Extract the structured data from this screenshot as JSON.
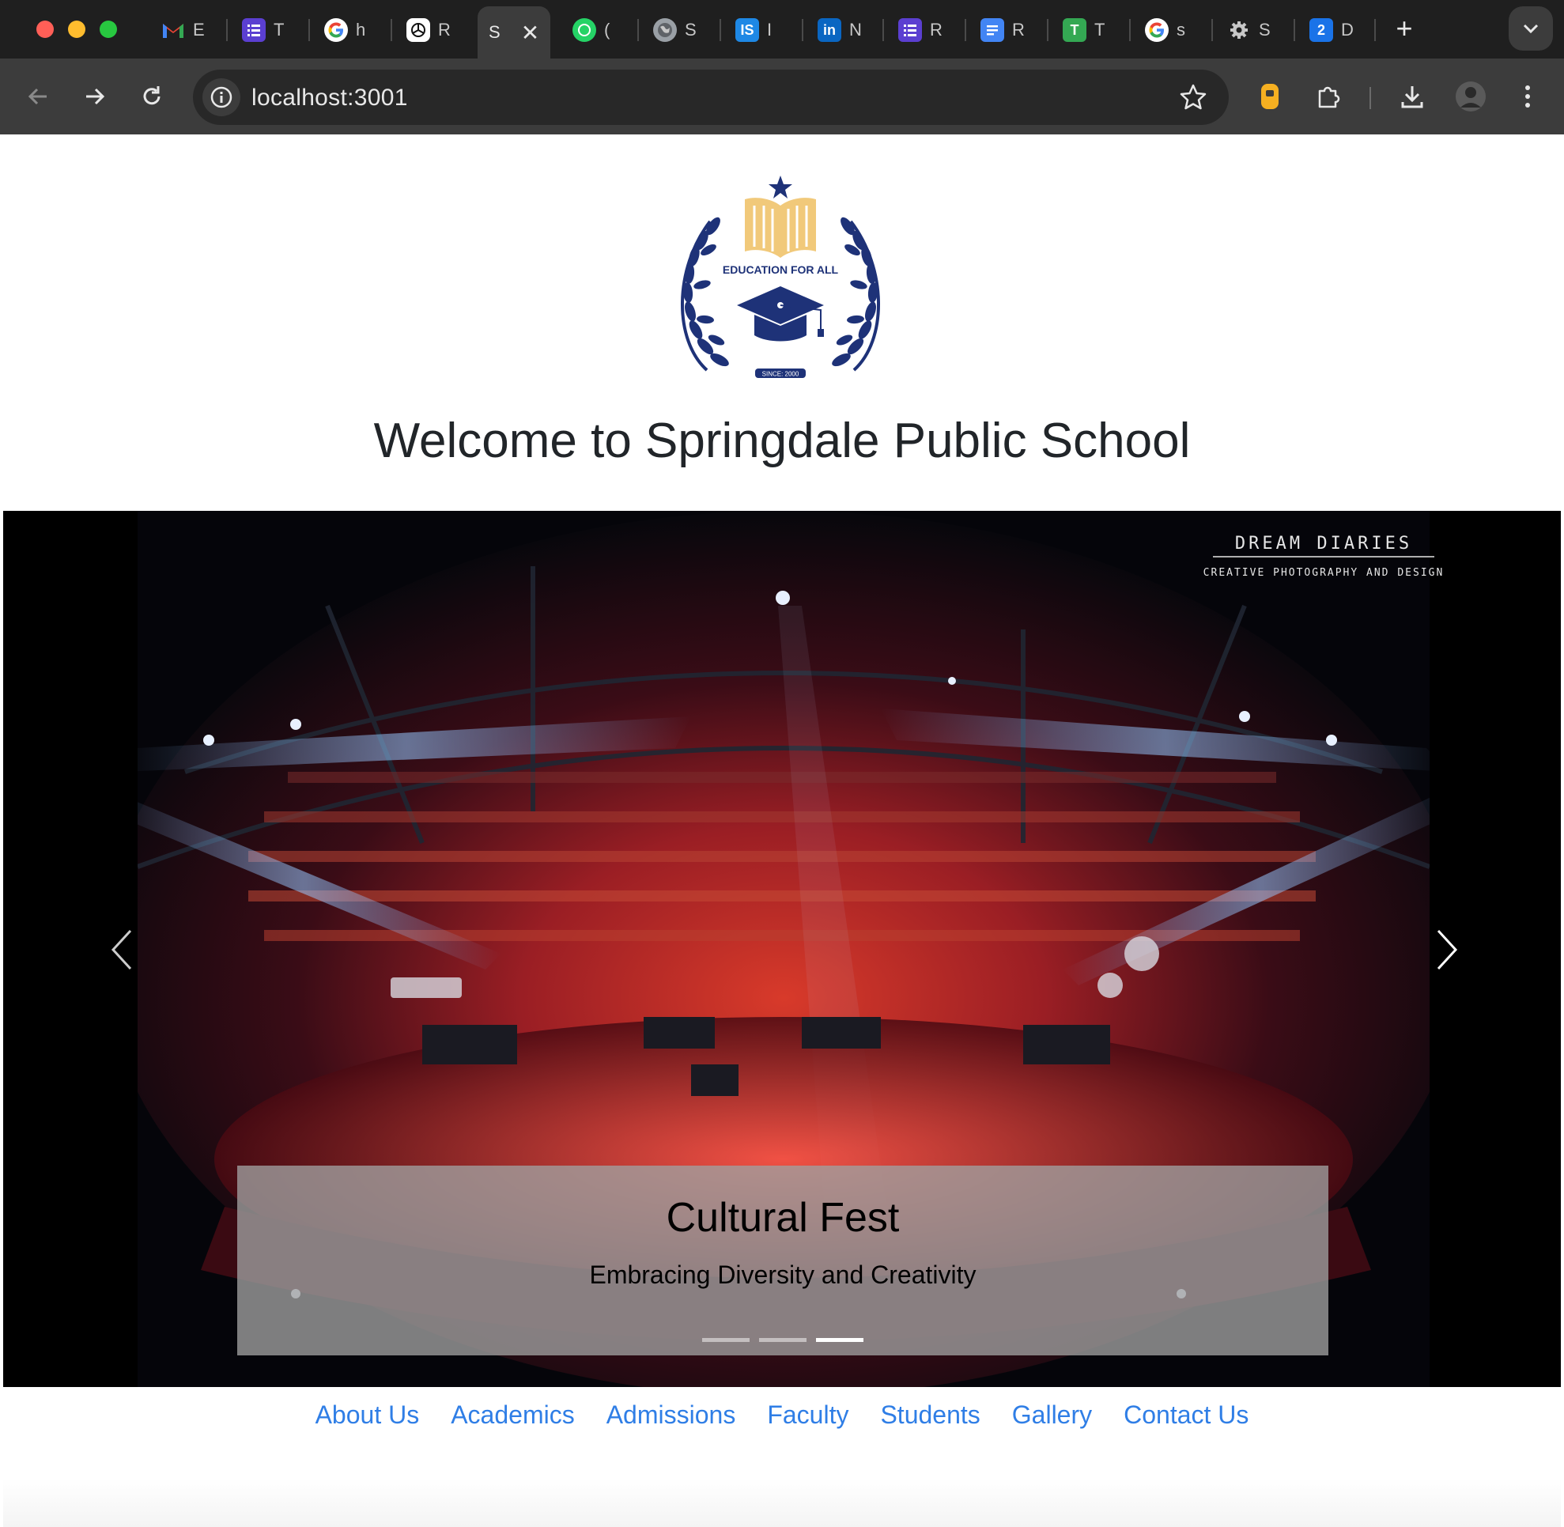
{
  "browser": {
    "tabs": [
      {
        "name": "gmail",
        "letter": "E",
        "icon": "gmail-icon",
        "color": "#ea4335"
      },
      {
        "name": "forms-1",
        "letter": "T",
        "icon": "list-icon",
        "color": "#5b3fd1"
      },
      {
        "name": "google-1",
        "letter": "h",
        "icon": "google-icon",
        "color": "#ffffff"
      },
      {
        "name": "chatgpt",
        "letter": "R",
        "icon": "chatgpt-icon",
        "color": "#ffffff"
      },
      {
        "name": "active",
        "letter": "S",
        "icon": "page-icon",
        "color": "#3c3c3c"
      },
      {
        "name": "whatsapp",
        "letter": "(",
        "icon": "whatsapp-icon",
        "color": "#25d366"
      },
      {
        "name": "globe",
        "letter": "S",
        "icon": "globe-icon",
        "color": "#9aa0a6"
      },
      {
        "name": "is",
        "letter": "I",
        "icon": "is-icon",
        "color": "#1e88e5"
      },
      {
        "name": "linkedin",
        "letter": "N",
        "icon": "linkedin-icon",
        "color": "#0a66c2"
      },
      {
        "name": "forms-2",
        "letter": "R",
        "icon": "list-icon",
        "color": "#5b3fd1"
      },
      {
        "name": "docs",
        "letter": "R",
        "icon": "docs-icon",
        "color": "#4285f4"
      },
      {
        "name": "t-app",
        "letter": "T",
        "icon": "t-icon",
        "color": "#34a853"
      },
      {
        "name": "google-2",
        "letter": "s",
        "icon": "google-icon",
        "color": "#ffffff"
      },
      {
        "name": "settings",
        "letter": "S",
        "icon": "gear-icon",
        "color": "#c7c7c7"
      },
      {
        "name": "two",
        "letter": "D",
        "icon": "two-icon",
        "color": "#1a73e8"
      }
    ],
    "new_tab_glyph": "+",
    "close_glyph": "✕",
    "url": "localhost:3001"
  },
  "page": {
    "logo": {
      "tagline": "EDUCATION FOR ALL",
      "since": "SINCE: 2000",
      "brand_color": "#1e3278",
      "book_color": "#f1c97a"
    },
    "welcome": "Welcome to Springdale Public School",
    "carousel": {
      "watermark_title": "DREAM DIARIES",
      "watermark_subtitle": "CREATIVE PHOTOGRAPHY AND DESIGN",
      "caption_title": "Cultural Fest",
      "caption_text": "Embracing Diversity and Creativity",
      "slide_count": 3,
      "active_slide": 3
    },
    "nav": [
      "About Us",
      "Academics",
      "Admissions",
      "Faculty",
      "Students",
      "Gallery",
      "Contact Us"
    ],
    "link_color": "#2f7ee6"
  }
}
